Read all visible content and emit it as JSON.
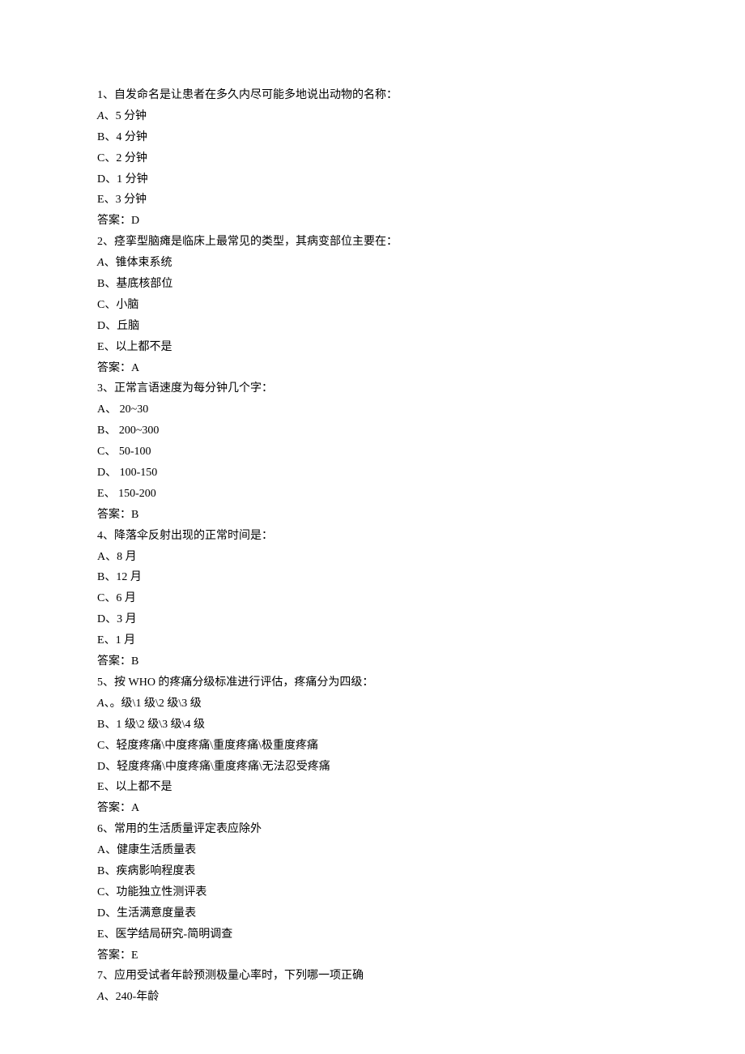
{
  "questions": [
    {
      "number": "1",
      "stem": "自发命名是让患者在多久内尽可能多地说出动物的名称：",
      "options": [
        {
          "letter": "A",
          "italic": true,
          "text": "5 分钟"
        },
        {
          "letter": "B",
          "italic": false,
          "text": "4 分钟"
        },
        {
          "letter": "C",
          "italic": false,
          "text": "2 分钟"
        },
        {
          "letter": "D",
          "italic": false,
          "text": "1 分钟"
        },
        {
          "letter": "E",
          "italic": false,
          "text": "3 分钟"
        }
      ],
      "answer": "答案：D"
    },
    {
      "number": "2",
      "stem": "痉挛型脑瘫是临床上最常见的类型，其病变部位主要在：",
      "options": [
        {
          "letter": "A",
          "italic": true,
          "text": "锥体束系统"
        },
        {
          "letter": "B",
          "italic": false,
          "text": "基底核部位"
        },
        {
          "letter": "C",
          "italic": false,
          "text": "小脑"
        },
        {
          "letter": "D",
          "italic": false,
          "text": "丘脑"
        },
        {
          "letter": "E",
          "italic": false,
          "text": "以上都不是"
        }
      ],
      "answer": "答案：A"
    },
    {
      "number": "3",
      "stem": "正常言语速度为每分钟几个字：",
      "options": [
        {
          "letter": "A",
          "italic": false,
          "text": " 20~30"
        },
        {
          "letter": "B",
          "italic": false,
          "text": " 200~300"
        },
        {
          "letter": "C",
          "italic": false,
          "text": " 50-100"
        },
        {
          "letter": "D",
          "italic": false,
          "text": " 100-150"
        },
        {
          "letter": "E",
          "italic": false,
          "text": " 150-200"
        }
      ],
      "answer": "答案：B"
    },
    {
      "number": "4",
      "stem": "降落伞反射出现的正常时间是：",
      "options": [
        {
          "letter": "A",
          "italic": false,
          "text": "8 月"
        },
        {
          "letter": "B",
          "italic": false,
          "text": "12 月"
        },
        {
          "letter": "C",
          "italic": false,
          "text": "6 月"
        },
        {
          "letter": "D",
          "italic": false,
          "text": "3 月"
        },
        {
          "letter": "E",
          "italic": false,
          "text": "1 月"
        }
      ],
      "answer": "答案：B"
    },
    {
      "number": "5",
      "stem": "按 WHO 的疼痛分级标准进行评估，疼痛分为四级：",
      "options": [
        {
          "letter": "A",
          "italic": true,
          "text": "。级\\1 级\\2 级\\3 级"
        },
        {
          "letter": "B",
          "italic": false,
          "text": "1 级\\2 级\\3 级\\4 级"
        },
        {
          "letter": "C",
          "italic": false,
          "text": "轻度疼痛\\中度疼痛\\重度疼痛\\极重度疼痛"
        },
        {
          "letter": "D",
          "italic": false,
          "text": "轻度疼痛\\中度疼痛\\重度疼痛\\无法忍受疼痛"
        },
        {
          "letter": "E",
          "italic": false,
          "text": "以上都不是"
        }
      ],
      "answer": "答案：A"
    },
    {
      "number": "6",
      "stem": "常用的生活质量评定表应除外",
      "options": [
        {
          "letter": "A",
          "italic": false,
          "text": "健康生活质量表"
        },
        {
          "letter": "B",
          "italic": false,
          "text": "疾病影响程度表"
        },
        {
          "letter": "C",
          "italic": false,
          "text": "功能独立性测评表"
        },
        {
          "letter": "D",
          "italic": false,
          "text": "生活满意度量表"
        },
        {
          "letter": "E",
          "italic": false,
          "text": "医学结局研究-简明调查"
        }
      ],
      "answer": "答案：E"
    },
    {
      "number": "7",
      "stem": "应用受试者年龄预测极量心率时，下列哪一项正确",
      "options": [
        {
          "letter": "A",
          "italic": true,
          "text": "240-年龄"
        }
      ],
      "answer": null
    }
  ]
}
